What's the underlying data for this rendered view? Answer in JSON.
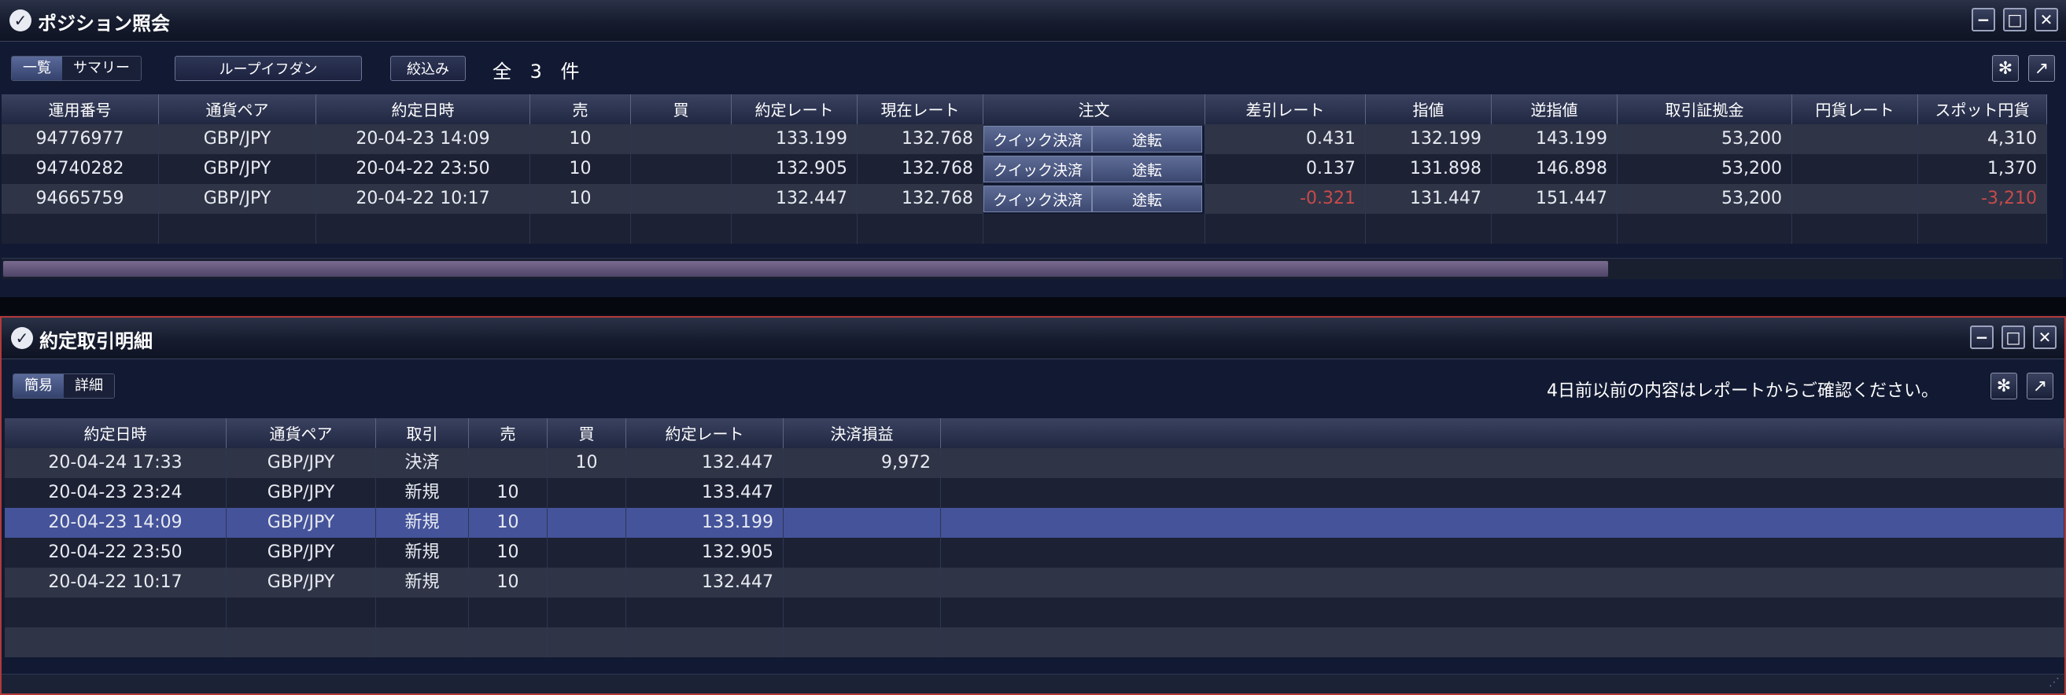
{
  "positions": {
    "title": "ポジション照会",
    "view_tabs": [
      "一覧",
      "サマリー"
    ],
    "loop_ifd_button": "ループイフダン",
    "filter_button": "絞込み",
    "count_text": "全 3 件",
    "columns": [
      "運用番号",
      "通貨ペア",
      "約定日時",
      "売",
      "買",
      "約定レート",
      "現在レート",
      "注文",
      "差引レート",
      "指値",
      "逆指値",
      "取引証拠金",
      "円貨レート",
      "スポット円貨"
    ],
    "quick_settle_label": "クイック決済",
    "midway_label": "途転",
    "rows": [
      {
        "id": "94776977",
        "pair": "GBP/JPY",
        "datetime": "20-04-23 14:09",
        "sell": "10",
        "buy": "",
        "rate": "133.199",
        "current": "132.768",
        "diff": "0.431",
        "limit": "132.199",
        "stop": "143.199",
        "margin": "53,200",
        "yen_rate": "",
        "spot": "4,310",
        "negative": false
      },
      {
        "id": "94740282",
        "pair": "GBP/JPY",
        "datetime": "20-04-22 23:50",
        "sell": "10",
        "buy": "",
        "rate": "132.905",
        "current": "132.768",
        "diff": "0.137",
        "limit": "131.898",
        "stop": "146.898",
        "margin": "53,200",
        "yen_rate": "",
        "spot": "1,370",
        "negative": false
      },
      {
        "id": "94665759",
        "pair": "GBP/JPY",
        "datetime": "20-04-22 10:17",
        "sell": "10",
        "buy": "",
        "rate": "132.447",
        "current": "132.768",
        "diff": "-0.321",
        "limit": "131.447",
        "stop": "151.447",
        "margin": "53,200",
        "yen_rate": "",
        "spot": "-3,210",
        "negative": true
      }
    ]
  },
  "trades": {
    "title": "約定取引明細",
    "view_tabs": [
      "簡易",
      "詳細"
    ],
    "notice": "4日前以前の内容はレポートからご確認ください。",
    "columns": [
      "約定日時",
      "通貨ペア",
      "取引",
      "売",
      "買",
      "約定レート",
      "決済損益"
    ],
    "rows": [
      {
        "datetime": "20-04-24 17:33",
        "pair": "GBP/JPY",
        "type": "決済",
        "sell": "",
        "buy": "10",
        "rate": "132.447",
        "pnl": "9,972"
      },
      {
        "datetime": "20-04-23 23:24",
        "pair": "GBP/JPY",
        "type": "新規",
        "sell": "10",
        "buy": "",
        "rate": "133.447",
        "pnl": ""
      },
      {
        "datetime": "20-04-23 14:09",
        "pair": "GBP/JPY",
        "type": "新規",
        "sell": "10",
        "buy": "",
        "rate": "133.199",
        "pnl": "",
        "selected": true
      },
      {
        "datetime": "20-04-22 23:50",
        "pair": "GBP/JPY",
        "type": "新規",
        "sell": "10",
        "buy": "",
        "rate": "132.905",
        "pnl": ""
      },
      {
        "datetime": "20-04-22 10:17",
        "pair": "GBP/JPY",
        "type": "新規",
        "sell": "10",
        "buy": "",
        "rate": "132.447",
        "pnl": ""
      }
    ]
  },
  "window_controls": {
    "minimize": "−",
    "maximize": "□",
    "close": "✕"
  },
  "icons": {
    "app_logo": "✓",
    "settings": "✻",
    "popout": "↗"
  },
  "colors": {
    "negative": "#c84a4a",
    "selected_row": "#44539a",
    "panel_bg": "#121a33",
    "active_border": "#b23a3a"
  }
}
